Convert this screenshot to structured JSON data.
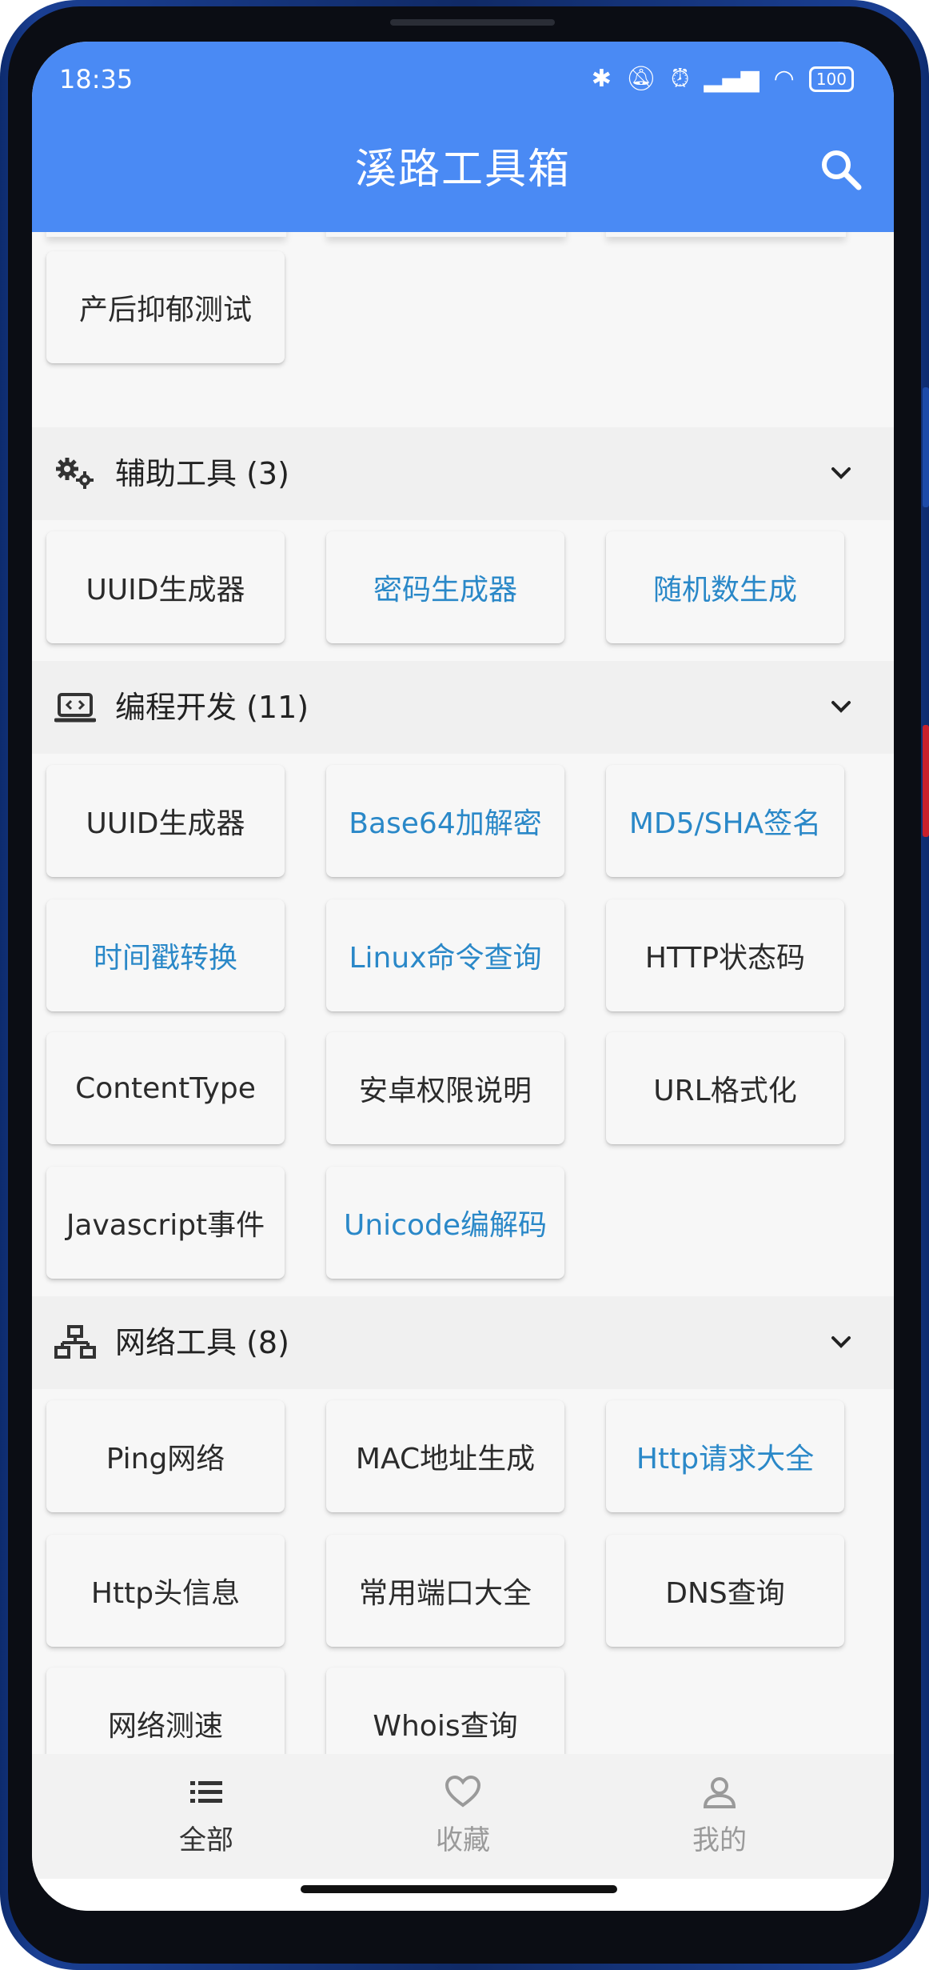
{
  "status_bar": {
    "time": "18:35",
    "battery": "100"
  },
  "header": {
    "title": "溪路工具箱"
  },
  "top_partial": {
    "tiles": [
      {
        "label": "产后抑郁测试",
        "highlighted": false
      }
    ]
  },
  "sections": [
    {
      "title": "辅助工具 (3)",
      "icon": "gears-icon",
      "tiles": [
        {
          "label": "UUID生成器",
          "highlighted": false
        },
        {
          "label": "密码生成器",
          "highlighted": true
        },
        {
          "label": "随机数生成",
          "highlighted": true
        }
      ]
    },
    {
      "title": "编程开发 (11)",
      "icon": "code-laptop-icon",
      "tiles": [
        {
          "label": "UUID生成器",
          "highlighted": false
        },
        {
          "label": "Base64加解密",
          "highlighted": true
        },
        {
          "label": "MD5/SHA签名",
          "highlighted": true
        },
        {
          "label": "时间戳转换",
          "highlighted": true
        },
        {
          "label": "Linux命令查询",
          "highlighted": true
        },
        {
          "label": "HTTP状态码",
          "highlighted": false
        },
        {
          "label": "ContentType",
          "highlighted": false
        },
        {
          "label": "安卓权限说明",
          "highlighted": false
        },
        {
          "label": "URL格式化",
          "highlighted": false
        },
        {
          "label": "Javascript事件",
          "highlighted": false
        },
        {
          "label": "Unicode编解码",
          "highlighted": true
        }
      ]
    },
    {
      "title": "网络工具 (8)",
      "icon": "network-icon",
      "tiles": [
        {
          "label": "Ping网络",
          "highlighted": false
        },
        {
          "label": "MAC地址生成",
          "highlighted": false
        },
        {
          "label": "Http请求大全",
          "highlighted": true
        },
        {
          "label": "Http头信息",
          "highlighted": false
        },
        {
          "label": "常用端口大全",
          "highlighted": false
        },
        {
          "label": "DNS查询",
          "highlighted": false
        },
        {
          "label": "网络测速",
          "highlighted": false
        },
        {
          "label": "Whois查询",
          "highlighted": false
        }
      ]
    }
  ],
  "bottom_nav": [
    {
      "label": "全部",
      "icon": "list-icon",
      "active": true
    },
    {
      "label": "收藏",
      "icon": "heart-icon",
      "active": false
    },
    {
      "label": "我的",
      "icon": "person-icon",
      "active": false
    }
  ],
  "colors": {
    "primary": "#4a8af4",
    "highlight_text": "#2a88c8",
    "normal_text": "#2b2b2b"
  }
}
